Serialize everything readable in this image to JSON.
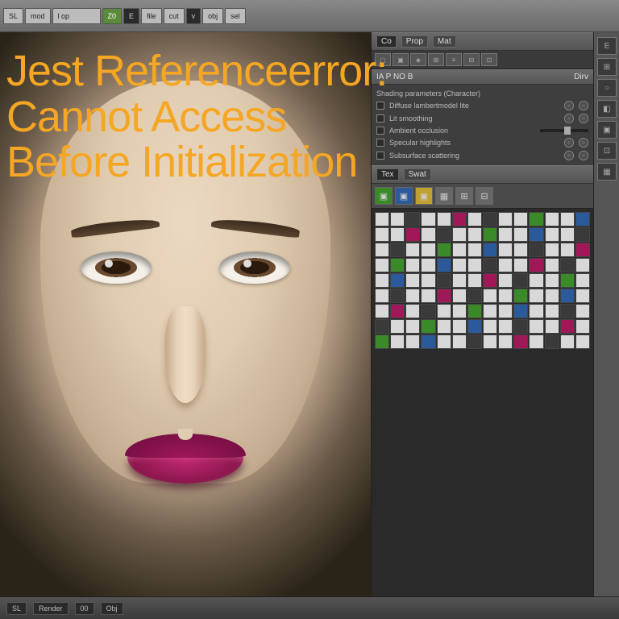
{
  "headline": {
    "line1": "Jest Referenceerror:",
    "line2": "Cannot Access",
    "line3": "Before Initialization"
  },
  "colors": {
    "accent": "#f5a623",
    "lips": "#a01858",
    "green": "#3a8a2a"
  },
  "toolbar": {
    "items": [
      "SL",
      "mod",
      "l op",
      "Z0",
      "E",
      "file",
      "cut",
      "v",
      "obj",
      "sel"
    ]
  },
  "panels": {
    "top": {
      "tabs": [
        "Co",
        "Prop",
        "Mat"
      ],
      "label": "IA P NO B",
      "sub": "Dirv"
    },
    "params": [
      "Diffuse lambertmodel lite",
      "Lit smoothing",
      "Ambient occlusion",
      "Specular highlights",
      "Subsurface scattering"
    ],
    "groupLabel": "Shading parameters (Character)",
    "lower": {
      "tabs": [
        "Tex",
        "Swat"
      ]
    }
  },
  "rightStrip": [
    "E",
    "⊞",
    "○",
    "◧",
    "▣",
    "⊡",
    "▦"
  ],
  "status": {
    "left": "SL",
    "mode": "Render",
    "frame": "00",
    "info": "Obj"
  }
}
